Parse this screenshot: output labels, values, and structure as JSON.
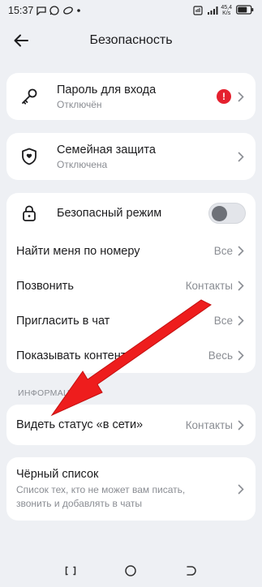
{
  "status_bar": {
    "time": "15:37",
    "net_speed_value": "45,4",
    "net_speed_unit": "K/s"
  },
  "header": {
    "title": "Безопасность"
  },
  "password": {
    "label": "Пароль для входа",
    "sub": "Отключён",
    "badge": "!"
  },
  "family": {
    "label": "Семейная защита",
    "sub": "Отключена"
  },
  "privacy": {
    "safe_mode_label": "Безопасный режим",
    "safe_mode_on": false,
    "rows": [
      {
        "label": "Найти меня по номеру",
        "value": "Все"
      },
      {
        "label": "Позвонить",
        "value": "Контакты"
      },
      {
        "label": "Пригласить в чат",
        "value": "Все"
      },
      {
        "label": "Показывать контент",
        "value": "Весь"
      }
    ]
  },
  "info": {
    "section_label": "ИНФОРМАЦИЯ",
    "online_label": "Видеть статус «в сети»",
    "online_value": "Контакты"
  },
  "blacklist": {
    "label": "Чёрный список",
    "sub": "Список тех, кто не может вам писать, звонить и добавлять в чаты"
  },
  "colors": {
    "accent_red": "#e5202e",
    "arrow_red": "#ee1d1d"
  }
}
